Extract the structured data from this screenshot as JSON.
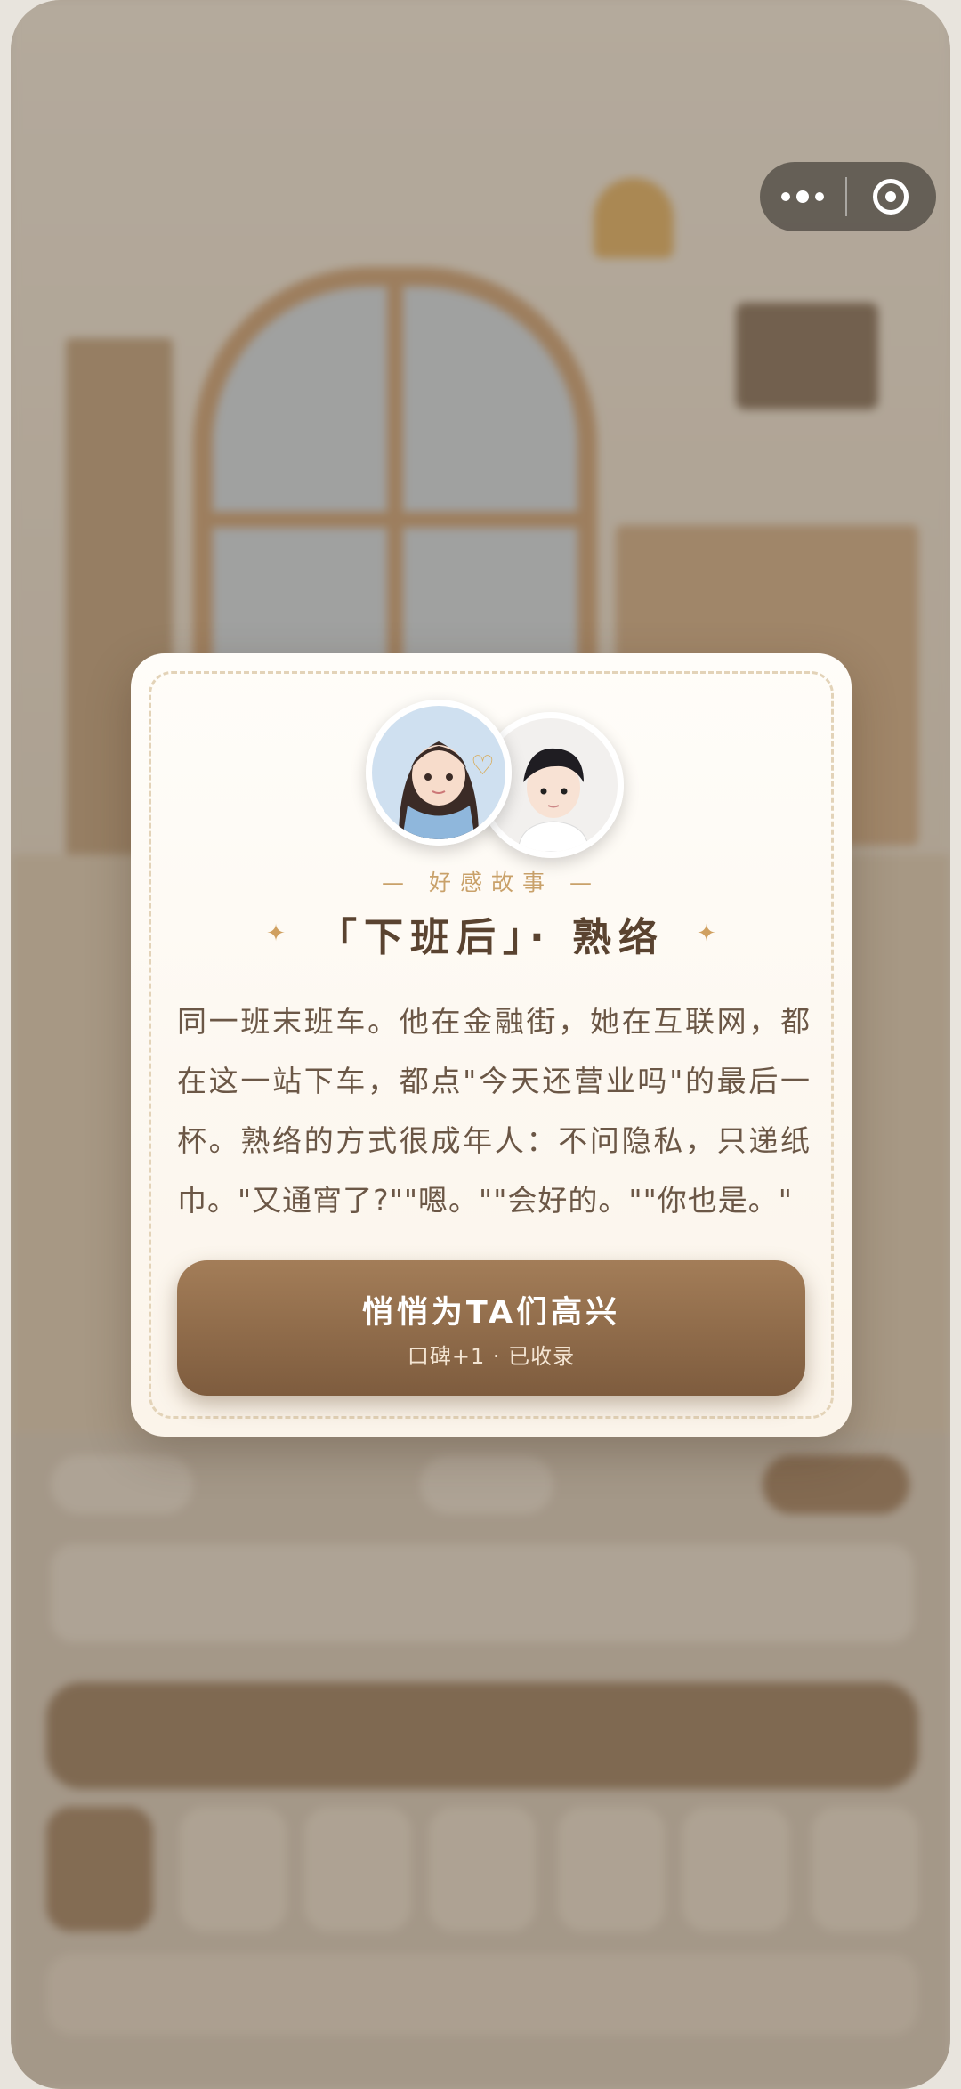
{
  "card": {
    "eyebrow": "— 好感故事 —",
    "title": "「下班后」· 熟络",
    "story": "同一班末班车。他在金融街，她在互联网，都在这一站下车，都点\"今天还营业吗\"的最后一杯。熟络的方式很成年人：不问隐私，只递纸巾。\"又通宵了?\"\"嗯。\"\"会好的。\"\"你也是。\"",
    "cta_label": "悄悄为TA们高兴",
    "cta_sub": "口碑+1 · 已收录"
  },
  "capsule": {
    "more_icon": "more-dots-icon",
    "close_icon": "target-close-icon"
  },
  "colors": {
    "accent": "#8a6a4a",
    "title": "#5a4330",
    "gold": "#c9a16a"
  }
}
